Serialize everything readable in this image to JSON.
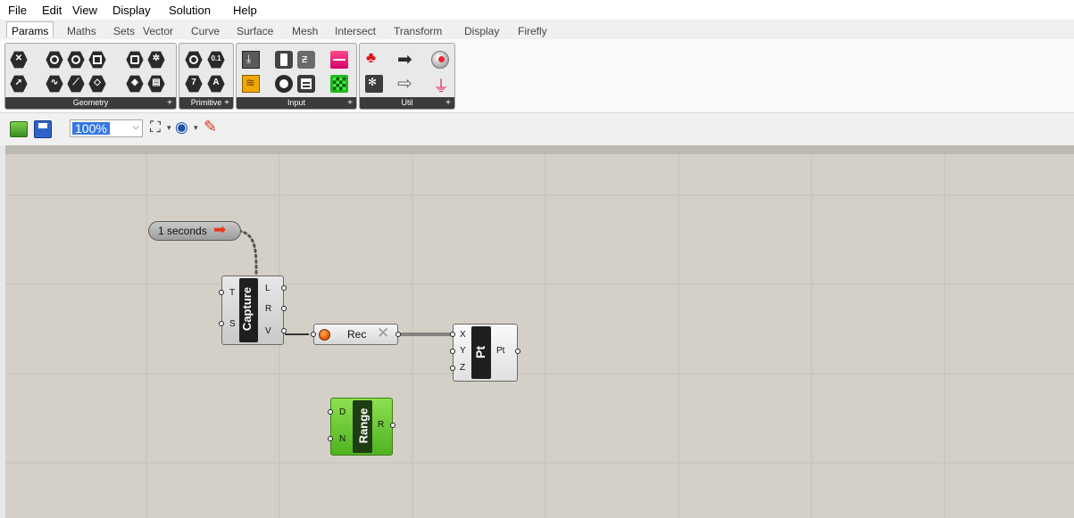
{
  "menu": {
    "items": [
      "File",
      "Edit",
      "View",
      "Display",
      "Solution",
      "Help"
    ]
  },
  "tabs": {
    "items": [
      "Params",
      "Maths",
      "Sets",
      "Vector",
      "Curve",
      "Surface",
      "Mesh",
      "Intersect",
      "Transform",
      "Display",
      "Firefly"
    ],
    "active": "Params"
  },
  "ribbon": {
    "groups": [
      {
        "label": "Geometry"
      },
      {
        "label": "Primitive"
      },
      {
        "label": "Input"
      },
      {
        "label": "Util"
      }
    ],
    "primitive_text_icons": [
      "0.1",
      "7",
      "A"
    ]
  },
  "toolbar": {
    "zoom": "100%"
  },
  "canvas": {
    "timer": {
      "label": "1 seconds"
    },
    "capture": {
      "title": "Capture",
      "inputs": [
        "T",
        "S"
      ],
      "outputs": [
        "L",
        "R",
        "V"
      ]
    },
    "recorder": {
      "label": "Rec"
    },
    "point": {
      "title": "Pt",
      "inputs": [
        "X",
        "Y",
        "Z"
      ],
      "outputs": [
        "Pt"
      ]
    },
    "range": {
      "title": "Range",
      "inputs": [
        "D",
        "N"
      ],
      "outputs": [
        "R"
      ]
    }
  },
  "colors": {
    "canvas": "#d4d0c8",
    "range_component": "#5cc12a",
    "recorder_dot": "#e84c00"
  }
}
